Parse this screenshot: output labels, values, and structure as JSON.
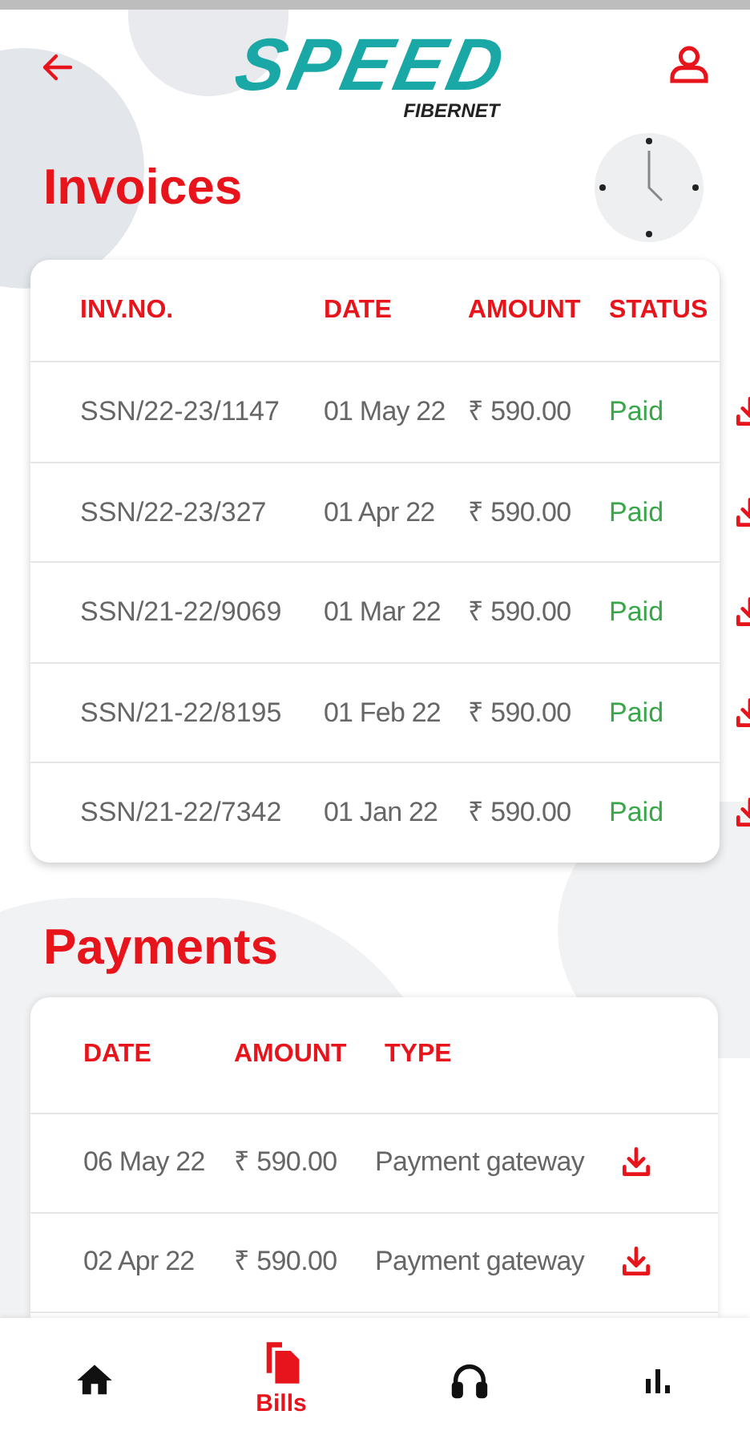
{
  "header": {
    "logo": "SPEED",
    "logo_sub": "FIBERNET"
  },
  "invoices": {
    "title": "Invoices",
    "columns": [
      "INV.NO.",
      "DATE",
      "AMOUNT",
      "STATUS"
    ],
    "rows": [
      {
        "number": "SSN/22-23/1147",
        "date": "01 May 22",
        "amount": "₹ 590.00",
        "status": "Paid"
      },
      {
        "number": "SSN/22-23/327",
        "date": "01 Apr 22",
        "amount": "₹ 590.00",
        "status": "Paid"
      },
      {
        "number": "SSN/21-22/9069",
        "date": "01 Mar 22",
        "amount": "₹ 590.00",
        "status": "Paid"
      },
      {
        "number": "SSN/21-22/8195",
        "date": "01 Feb 22",
        "amount": "₹ 590.00",
        "status": "Paid"
      },
      {
        "number": "SSN/21-22/7342",
        "date": "01 Jan 22",
        "amount": "₹ 590.00",
        "status": "Paid"
      }
    ]
  },
  "payments": {
    "title": "Payments",
    "columns": [
      "DATE",
      "AMOUNT",
      "TYPE"
    ],
    "rows": [
      {
        "date": "06 May 22",
        "amount": "₹ 590.00",
        "type": "Payment gateway"
      },
      {
        "date": "02 Apr 22",
        "amount": "₹ 590.00",
        "type": "Payment gateway"
      }
    ]
  },
  "nav": [
    {
      "kind": "home",
      "selected": false
    },
    {
      "kind": "bills",
      "label": "Bills",
      "selected": true
    },
    {
      "kind": "support",
      "selected": false
    },
    {
      "kind": "stats",
      "selected": false
    }
  ]
}
